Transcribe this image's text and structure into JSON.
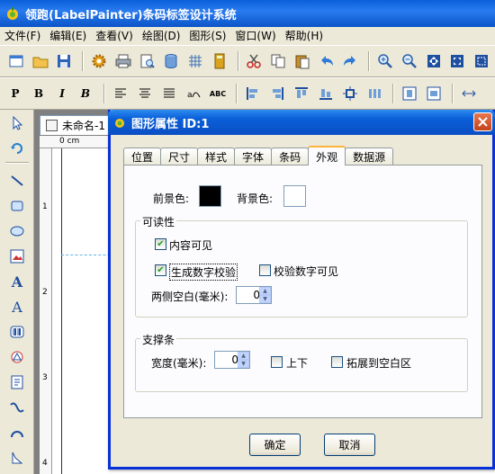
{
  "window": {
    "title": "领跑(LabelPainter)条码标签设计系统"
  },
  "menubar": [
    {
      "label": "文件(F)"
    },
    {
      "label": "编辑(E)"
    },
    {
      "label": "查看(V)"
    },
    {
      "label": "绘图(D)"
    },
    {
      "label": "图形(S)"
    },
    {
      "label": "窗口(W)"
    },
    {
      "label": "帮助(H)"
    }
  ],
  "toolbar2_text": {
    "bold_p": "P",
    "bold_b": "B",
    "italic_i": "I",
    "italic_b": "B",
    "abc": "ABC"
  },
  "document": {
    "tab_label": "未命名-1",
    "ruler_top_label": "0 cm",
    "ruler_left_ticks": [
      "1",
      "2",
      "3",
      "4"
    ]
  },
  "dialog": {
    "title": "图形属性  ID:1",
    "tabs": [
      "位置",
      "尺寸",
      "样式",
      "字体",
      "条码",
      "外观",
      "数据源"
    ],
    "active_tab": "外观",
    "foreground_label": "前景色:",
    "background_label": "背景色:",
    "foreground_color": "#000000",
    "background_color": "#ffffff",
    "readability": {
      "title": "可读性",
      "content_visible": {
        "label": "内容可见",
        "checked": true
      },
      "gen_check_digit": {
        "label": "生成数字校验",
        "checked": true
      },
      "check_digit_visible": {
        "label": "校验数字可见",
        "checked": false
      },
      "side_margin_label": "两侧空白(毫米):",
      "side_margin_value": "0"
    },
    "support_bar": {
      "title": "支撑条",
      "width_label": "宽度(毫米):",
      "width_value": "0",
      "top_bottom": {
        "label": "上下",
        "checked": false
      },
      "extend_blank": {
        "label": "拓展到空白区",
        "checked": false
      }
    },
    "ok_label": "确定",
    "cancel_label": "取消"
  }
}
